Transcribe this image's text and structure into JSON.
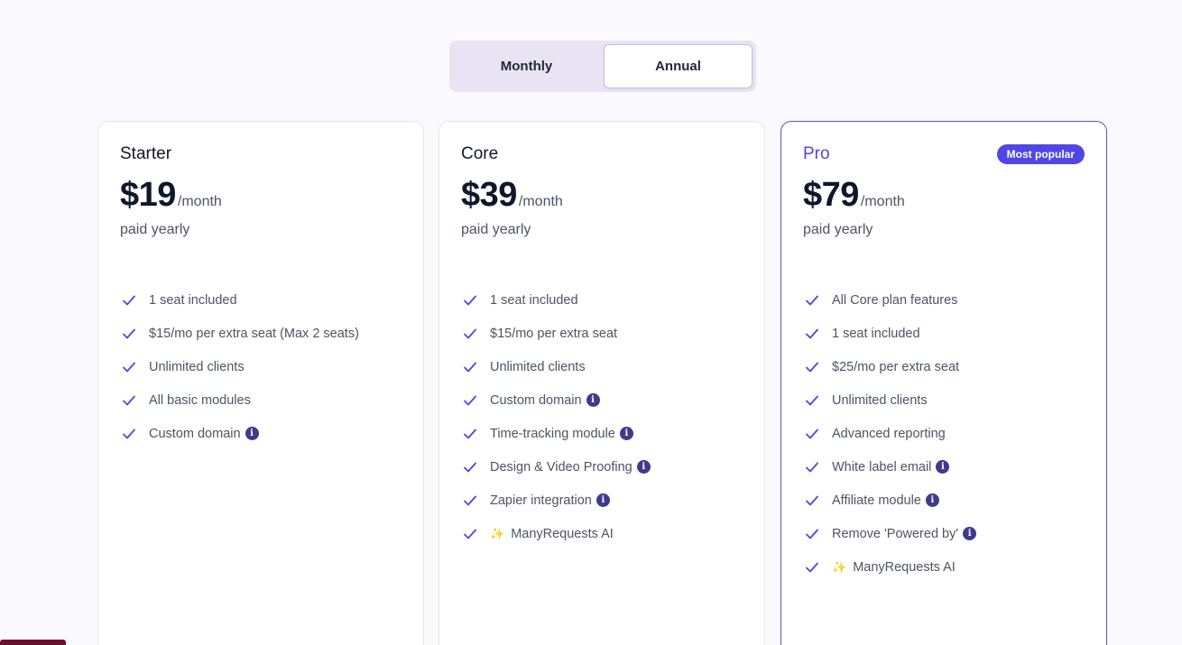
{
  "toggle": {
    "monthly": "Monthly",
    "annual": "Annual",
    "selected": "Annual"
  },
  "plans": [
    {
      "name": "Starter",
      "price": "$19",
      "per": "/month",
      "billing": "paid yearly",
      "features": [
        {
          "text": "1 seat included"
        },
        {
          "text": "$15/mo per extra seat (Max 2 seats)"
        },
        {
          "text": "Unlimited clients"
        },
        {
          "text": "All basic modules"
        },
        {
          "text": "Custom domain",
          "info": true
        }
      ]
    },
    {
      "name": "Core",
      "price": "$39",
      "per": "/month",
      "billing": "paid yearly",
      "features": [
        {
          "text": "1 seat included"
        },
        {
          "text": "$15/mo per extra seat"
        },
        {
          "text": "Unlimited clients"
        },
        {
          "text": "Custom domain",
          "info": true
        },
        {
          "text": "Time-tracking module",
          "info": true
        },
        {
          "text": "Design & Video Proofing",
          "info": true
        },
        {
          "text": "Zapier integration",
          "info": true
        },
        {
          "text": "ManyRequests AI",
          "sparkle": true
        }
      ]
    },
    {
      "name": "Pro",
      "price": "$79",
      "per": "/month",
      "billing": "paid yearly",
      "badge": "Most popular",
      "features": [
        {
          "text": "All Core plan features"
        },
        {
          "text": "1 seat included"
        },
        {
          "text": "$25/mo per extra seat"
        },
        {
          "text": "Unlimited clients"
        },
        {
          "text": "Advanced reporting"
        },
        {
          "text": "White label email",
          "info": true
        },
        {
          "text": "Affiliate module",
          "info": true
        },
        {
          "text": "Remove 'Powered by'",
          "info": true
        },
        {
          "text": "ManyRequests AI",
          "sparkle": true
        }
      ]
    }
  ],
  "icons": {
    "check": "check-icon",
    "info": "info-icon",
    "sparkle": "sparkle-icon",
    "info_glyph": "i",
    "sparkle_glyph": "✨"
  },
  "colors": {
    "accent": "#4f46e5",
    "toggle_bg": "#e9e3f3",
    "page_bg": "#faf9fd"
  }
}
